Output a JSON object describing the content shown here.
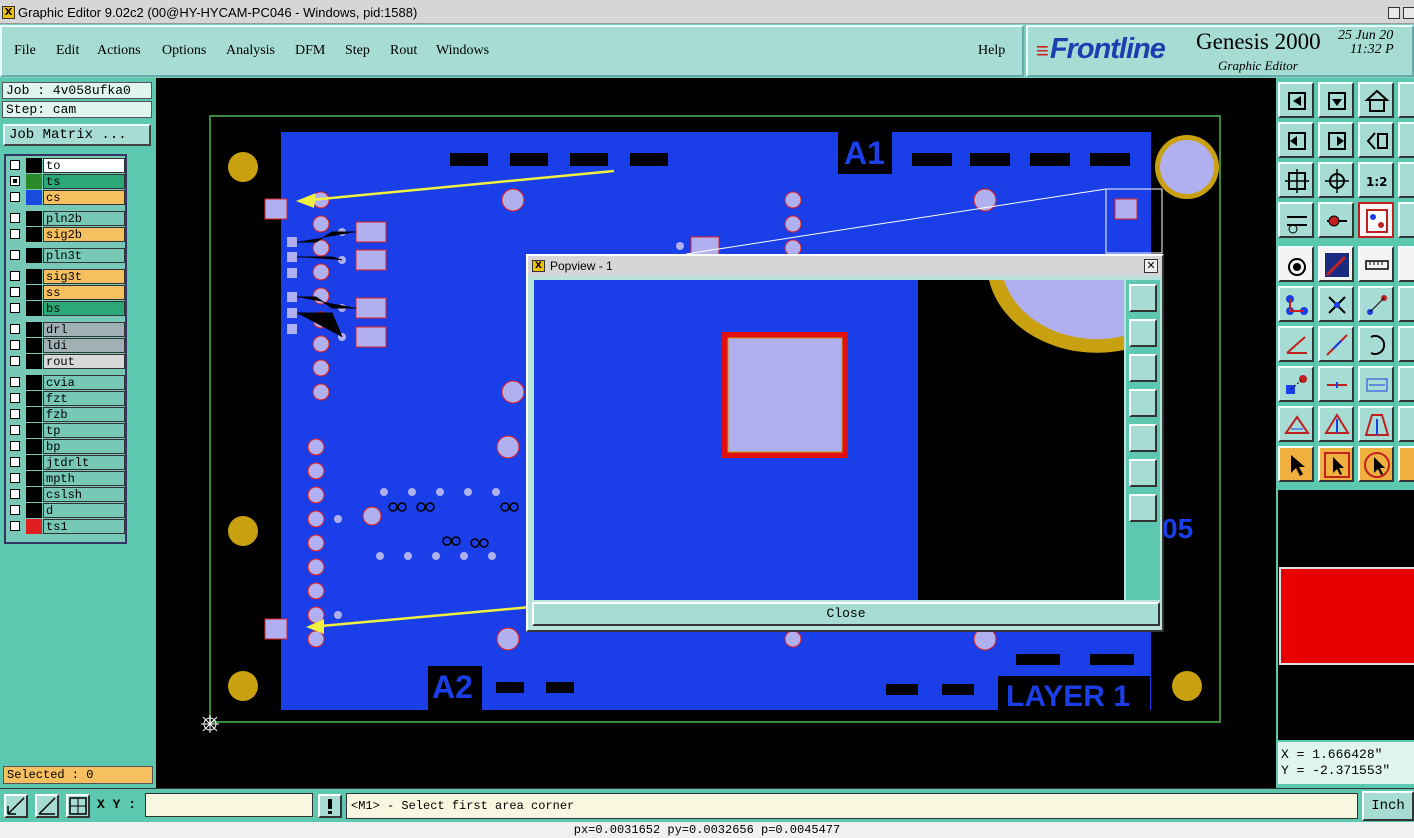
{
  "window": {
    "title": "Graphic Editor 9.02c2 (00@HY-HYCAM-PC046 - Windows, pid:1588)"
  },
  "menu": {
    "items": [
      "File",
      "Edit",
      "Actions",
      "Options",
      "Analysis",
      "DFM",
      "Step",
      "Rout",
      "Windows"
    ],
    "help": "Help"
  },
  "brand": {
    "logo": "Frontline",
    "product": "Genesis 2000",
    "subtitle": "Graphic Editor",
    "date": "25 Jun 20",
    "time": "11:32 P"
  },
  "left": {
    "job": "Job : 4v058ufka0",
    "step": "Step: cam",
    "job_matrix": "Job Matrix ...",
    "selected": "Selected : 0",
    "layers": [
      {
        "name": "to",
        "color": "#ffffff",
        "swatch": "#000000",
        "checked": false
      },
      {
        "name": "ts",
        "color": "#2aa878",
        "swatch": "#2a8a2a",
        "checked": true
      },
      {
        "name": "cs",
        "color": "#f6c060",
        "swatch": "#1a4ae0",
        "checked": false
      },
      {
        "name": "pln2b",
        "color": "#78c8b8",
        "swatch": "#000000",
        "checked": false
      },
      {
        "name": "sig2b",
        "color": "#f6c060",
        "swatch": "#000000",
        "checked": false
      },
      {
        "name": "pln3t",
        "color": "#78c8b8",
        "swatch": "#000000",
        "checked": false
      },
      {
        "name": "sig3t",
        "color": "#f6c060",
        "swatch": "#000000",
        "checked": false
      },
      {
        "name": "ss",
        "color": "#f6c060",
        "swatch": "#000000",
        "checked": false
      },
      {
        "name": "bs",
        "color": "#2aa878",
        "swatch": "#000000",
        "checked": false
      },
      {
        "name": "drl",
        "color": "#a0b0b4",
        "swatch": "#000000",
        "checked": false
      },
      {
        "name": "ldi",
        "color": "#a0b0b4",
        "swatch": "#000000",
        "checked": false
      },
      {
        "name": "rout",
        "color": "#d8d8d8",
        "swatch": "#000000",
        "checked": false
      },
      {
        "name": "cvia",
        "color": "#78c8b8",
        "swatch": "#000000",
        "checked": false
      },
      {
        "name": "fzt",
        "color": "#78c8b8",
        "swatch": "#000000",
        "checked": false
      },
      {
        "name": "fzb",
        "color": "#78c8b8",
        "swatch": "#000000",
        "checked": false
      },
      {
        "name": "tp",
        "color": "#78c8b8",
        "swatch": "#000000",
        "checked": false
      },
      {
        "name": "bp",
        "color": "#78c8b8",
        "swatch": "#000000",
        "checked": false
      },
      {
        "name": "jtdrlt",
        "color": "#78c8b8",
        "swatch": "#000000",
        "checked": false
      },
      {
        "name": "mpth",
        "color": "#78c8b8",
        "swatch": "#000000",
        "checked": false
      },
      {
        "name": "cslsh",
        "color": "#78c8b8",
        "swatch": "#000000",
        "checked": false
      },
      {
        "name": "d",
        "color": "#78c8b8",
        "swatch": "#000000",
        "checked": false
      },
      {
        "name": "ts1",
        "color": "#78c8b8",
        "swatch": "#e02020",
        "checked": false
      }
    ]
  },
  "canvas": {
    "labels": {
      "a1": "A1",
      "a2": "A2",
      "layer": "LAYER 1",
      "partial": "05"
    }
  },
  "popview": {
    "title": "Popview - 1",
    "close_label": "Close"
  },
  "right": {
    "x": "X = 1.666428\"",
    "y": "Y = -2.371553\"",
    "toolbar_icons": [
      "zoom-page-icon",
      "zoom-down-icon",
      "home-icon",
      "pan-left-icon",
      "pan-right-icon",
      "flip-icon",
      "fit-icon",
      "zoom-in-icon",
      "ratio-icon",
      "measure-icon",
      "snap-icon",
      "layer-icon"
    ]
  },
  "bottom": {
    "xy_label": "X Y :",
    "xy_value": "",
    "message": "<M1> - Select first area corner",
    "unit_button": "Inch",
    "status": "px=0.0031652 py=0.0032656 p=0.0045477"
  }
}
